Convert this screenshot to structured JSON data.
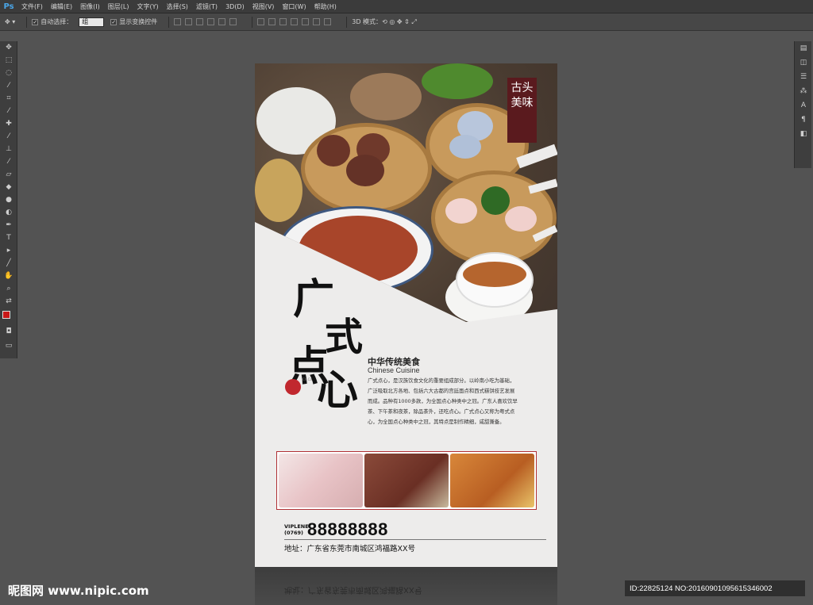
{
  "app": {
    "logo": "Ps",
    "menu": [
      "文件(F)",
      "编辑(E)",
      "图像(I)",
      "图层(L)",
      "文字(Y)",
      "选择(S)",
      "滤镜(T)",
      "3D(D)",
      "视图(V)",
      "窗口(W)",
      "帮助(H)"
    ]
  },
  "options": {
    "auto_select_label": "自动选择：",
    "auto_select_value": "组",
    "show_transform_label": "显示变换控件",
    "mode_3d_label": "3D 模式："
  },
  "poster": {
    "seal_text": "古头美味",
    "title_chars": [
      "广",
      "式",
      "点",
      "心"
    ],
    "subtitle_cn": "中华传统美食",
    "subtitle_en": "Chinese  Cuisine",
    "description": "广式点心，是汉族饮食文化的重要组成部分。以岭南小吃为基础，广泛吸取北方各地、包括六大古都的宫廷面点和西式糕饼技艺发展而成。品种有1000多款，为全国点心种类中之冠。广东人喜欢饮早茶、下午茶和夜茶，除品茶外，还吃点心。广式点心又称为粤式点心，为全国点心种类中之冠，其特点是制作精细，咸甜兼备。",
    "phone_label_top": "VIPLENE",
    "phone_label_bottom": "(0769)",
    "phone_number": "88888888",
    "address": "地址：广东省东莞市南城区鸿福路XX号",
    "reflection_text": "地址：广东省东莞市南城区鸿福路XX号"
  },
  "watermark": "昵图网 www.nipic.com",
  "image_id": "ID:22825124 NO:20160901095615346002",
  "colors": {
    "seal": "#5a1a1e",
    "stamp": "#c1282e",
    "strip_border": "#b03035",
    "ps_blue": "#4aa6e8"
  }
}
